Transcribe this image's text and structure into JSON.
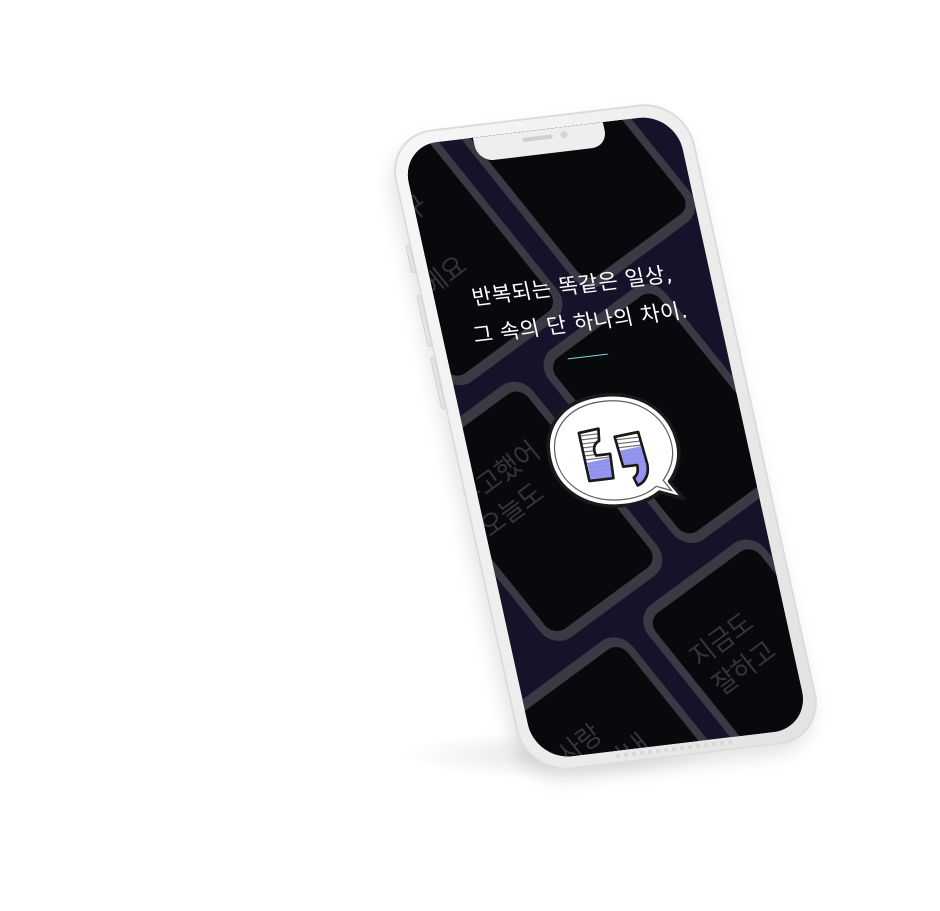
{
  "tagline": {
    "line1": "반복되는 똑같은 일상,",
    "line2": "그 속의 단 하나의 차이."
  },
  "background_tiles": [
    {
      "text": ""
    },
    {
      "text": "잘 했구\n중이\n흐에요"
    },
    {
      "text": ""
    },
    {
      "text": "수고했어\n오늘도"
    },
    {
      "text": ""
    },
    {
      "text": "사랑\n잘 지내"
    },
    {
      "text": "지금도\n잘하고"
    },
    {
      "text": ""
    }
  ],
  "logo": {
    "icon": "quote-speech-bubble-icon",
    "accent_color": "#8e90ee",
    "outline_color": "#1a1a1a"
  },
  "colors": {
    "screen_background": "#15132a",
    "tile_frame": "#3a3a44",
    "tile_screen": "#07090c",
    "divider": "#7fd3df",
    "phone_body": "#efefef"
  }
}
